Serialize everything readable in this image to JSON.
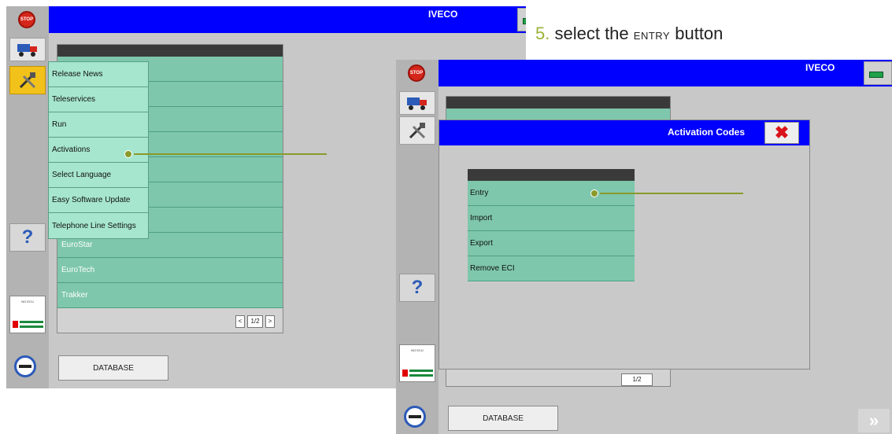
{
  "screen1": {
    "brand": "IVECO",
    "menu_items": [
      "Release News",
      "Teleservices",
      "Run",
      "Activations",
      "Select Language",
      "Easy Software Update",
      "Telephone Line Settings"
    ],
    "list_items": [
      "EuroStar",
      "EuroTech",
      "Trakker"
    ],
    "pager": {
      "prev": "<",
      "page": "1/2",
      "next": ">"
    },
    "ecu_label": "NO ECU",
    "database_button": "DATABASE"
  },
  "instruction": {
    "step_number": "5.",
    "text_before": "select the",
    "keyword": "ENTRY",
    "text_after": "button"
  },
  "screen2": {
    "brand": "IVECO",
    "dialog_title": "Activation Codes",
    "close_symbol": "✖",
    "dialog_items": [
      "Entry",
      "Import",
      "Export",
      "Remove ECI"
    ],
    "ecu_label": "NO ECU",
    "pager_text": "1/2",
    "database_button": "DATABASE",
    "next_symbol": "»"
  },
  "icons": {
    "stop": "STOP",
    "truck": "truck-icon",
    "tools": "tools-icon",
    "help": "?",
    "key": "key-icon"
  },
  "colors": {
    "titlebar": "#0000ff",
    "list_row": "#7ec7ad",
    "menu_bg": "#a6e6cf",
    "accent_leader": "#8a9a2a",
    "active_tool": "#f2c21b"
  }
}
